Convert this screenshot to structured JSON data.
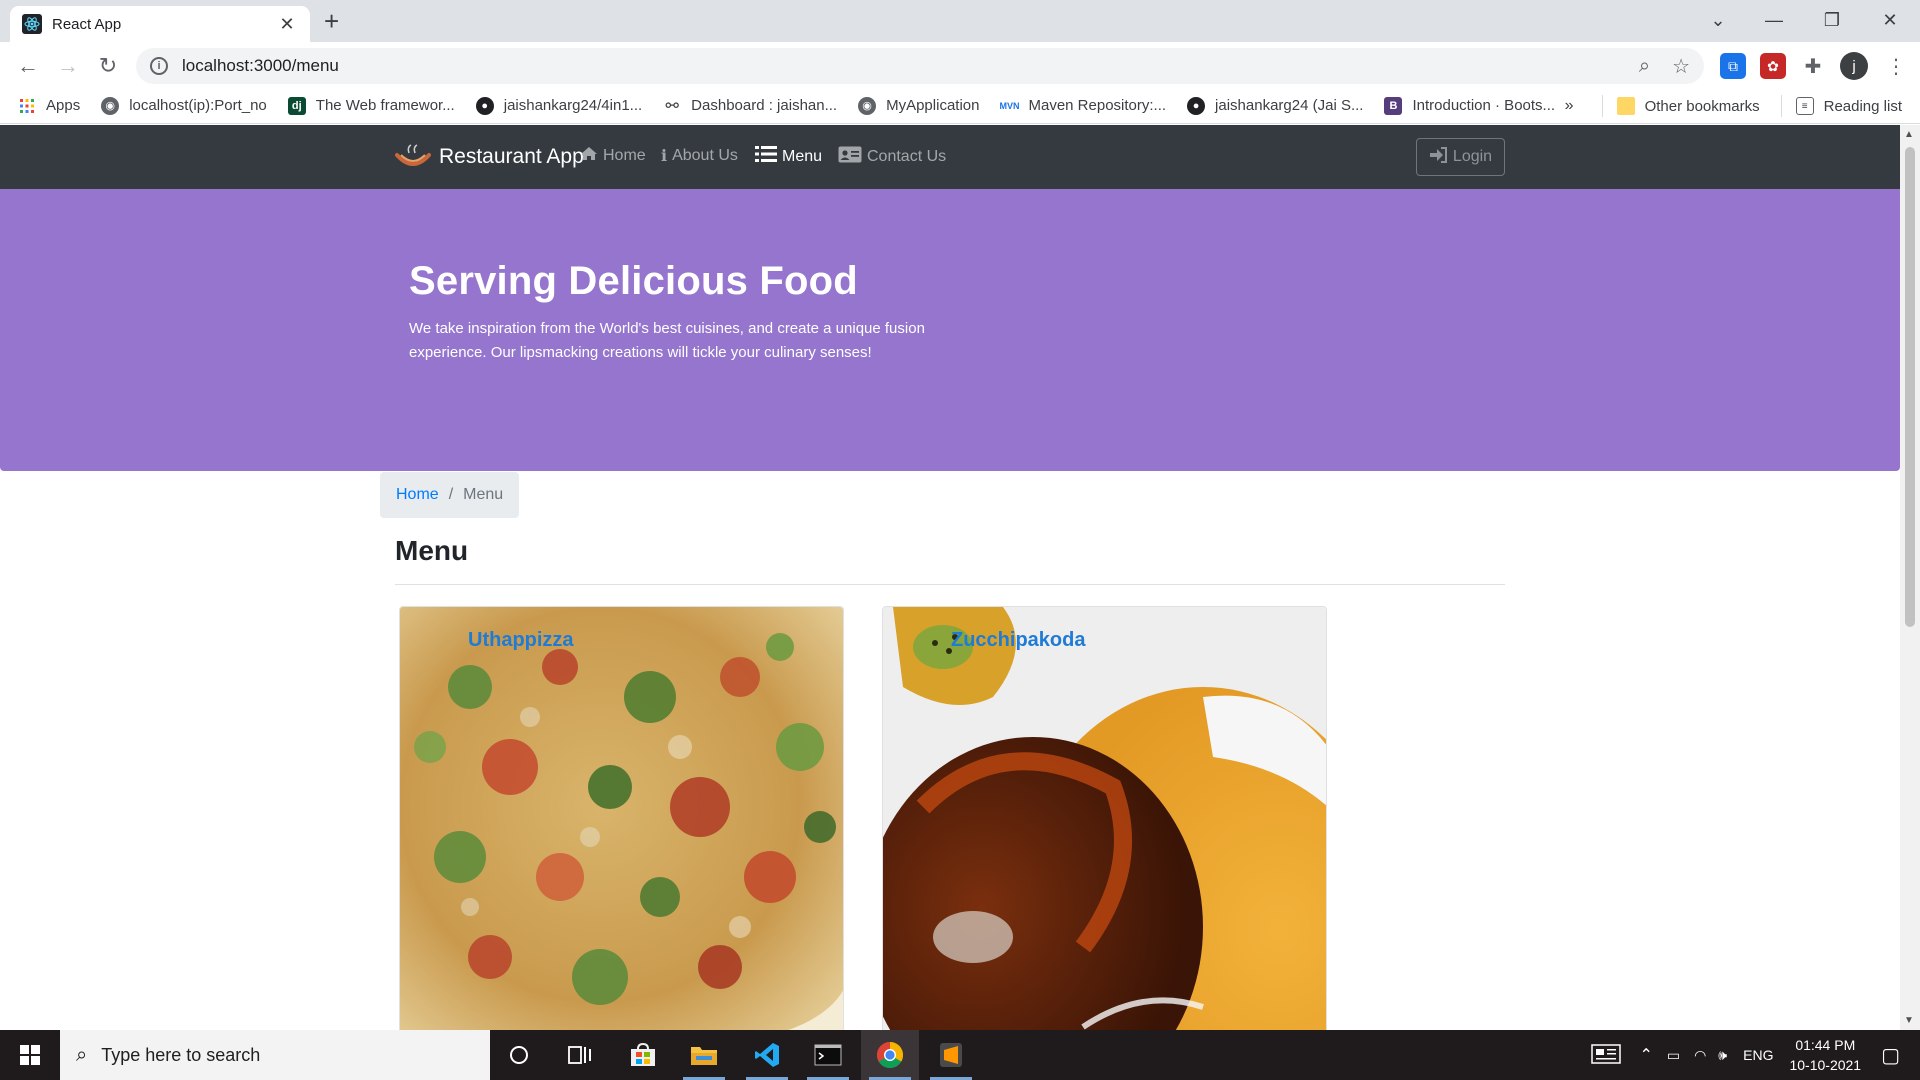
{
  "browser": {
    "tab_title": "React App",
    "url": "localhost:3000/menu",
    "bookmarks": [
      {
        "label": "Apps",
        "icon": "apps-grid-icon"
      },
      {
        "label": "localhost(ip):Port_no",
        "icon": "globe-icon"
      },
      {
        "label": "The Web framewor...",
        "icon": "django-icon"
      },
      {
        "label": "jaishankarg24/4in1...",
        "icon": "github-icon"
      },
      {
        "label": "Dashboard : jaishan...",
        "icon": "jenkins-icon"
      },
      {
        "label": "MyApplication",
        "icon": "globe-icon"
      },
      {
        "label": "Maven Repository:...",
        "icon": "maven-icon"
      },
      {
        "label": "jaishankarg24 (Jai S...",
        "icon": "github-icon"
      },
      {
        "label": "Introduction · Boots...",
        "icon": "bootstrap-icon"
      }
    ],
    "overflow_label": "»",
    "other_bookmarks": "Other bookmarks",
    "reading_list": "Reading list",
    "profile_initial": "j"
  },
  "app": {
    "brand": "Restaurant App",
    "nav": [
      {
        "label": "Home",
        "icon": "home-icon",
        "active": false
      },
      {
        "label": "About Us",
        "icon": "info-icon",
        "active": false
      },
      {
        "label": "Menu",
        "icon": "list-icon",
        "active": true
      },
      {
        "label": "Contact Us",
        "icon": "address-card-icon",
        "active": false
      }
    ],
    "login_label": "Login",
    "colors": {
      "navbar": "#343a40",
      "jumbotron": "#9575cd",
      "link": "#007bff"
    }
  },
  "jumbotron": {
    "title": "Serving Delicious Food",
    "text": "We take inspiration from the World's best cuisines, and create a unique fusion experience. Our lipsmacking creations will tickle your culinary senses!"
  },
  "breadcrumb": {
    "home": "Home",
    "separator": "/",
    "current": "Menu"
  },
  "menu": {
    "heading": "Menu",
    "dishes": [
      {
        "name": "Uthappizza"
      },
      {
        "name": "Zucchipakoda"
      }
    ]
  },
  "taskbar": {
    "search_placeholder": "Type here to search",
    "language": "ENG",
    "time": "01:44 PM",
    "date": "10-10-2021"
  }
}
